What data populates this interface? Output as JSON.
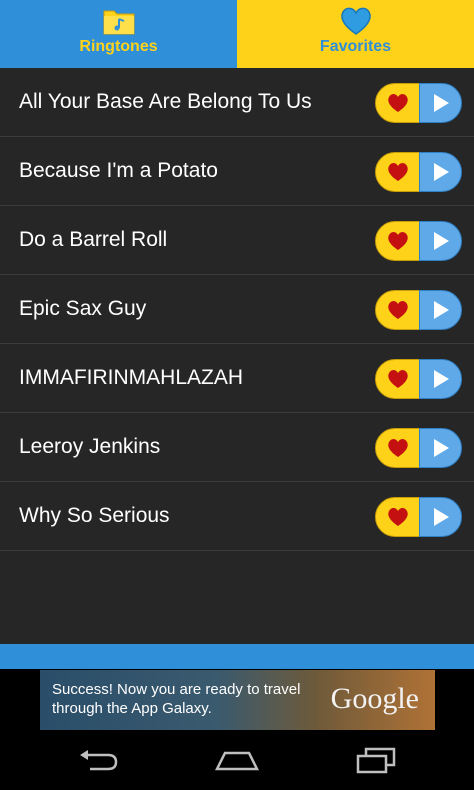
{
  "tabs": [
    {
      "label": "Ringtones",
      "icon": "folder-music-icon",
      "selected": false
    },
    {
      "label": "Favorites",
      "icon": "heart-icon",
      "selected": true
    }
  ],
  "ringtones": [
    {
      "title": "All Your Base Are Belong To Us"
    },
    {
      "title": "Because I'm a Potato"
    },
    {
      "title": "Do a Barrel Roll"
    },
    {
      "title": "Epic Sax Guy"
    },
    {
      "title": "IMMAFIRINMAHLAZAH"
    },
    {
      "title": "Leeroy Jenkins"
    },
    {
      "title": "Why So Serious"
    }
  ],
  "ad": {
    "message": "Success! Now you are ready to travel through the App Galaxy.",
    "brand": "Google"
  },
  "colors": {
    "blue": "#2f8fd8",
    "yellow": "#ffd21a",
    "heart": "#c41010",
    "list_bg": "#262626"
  }
}
